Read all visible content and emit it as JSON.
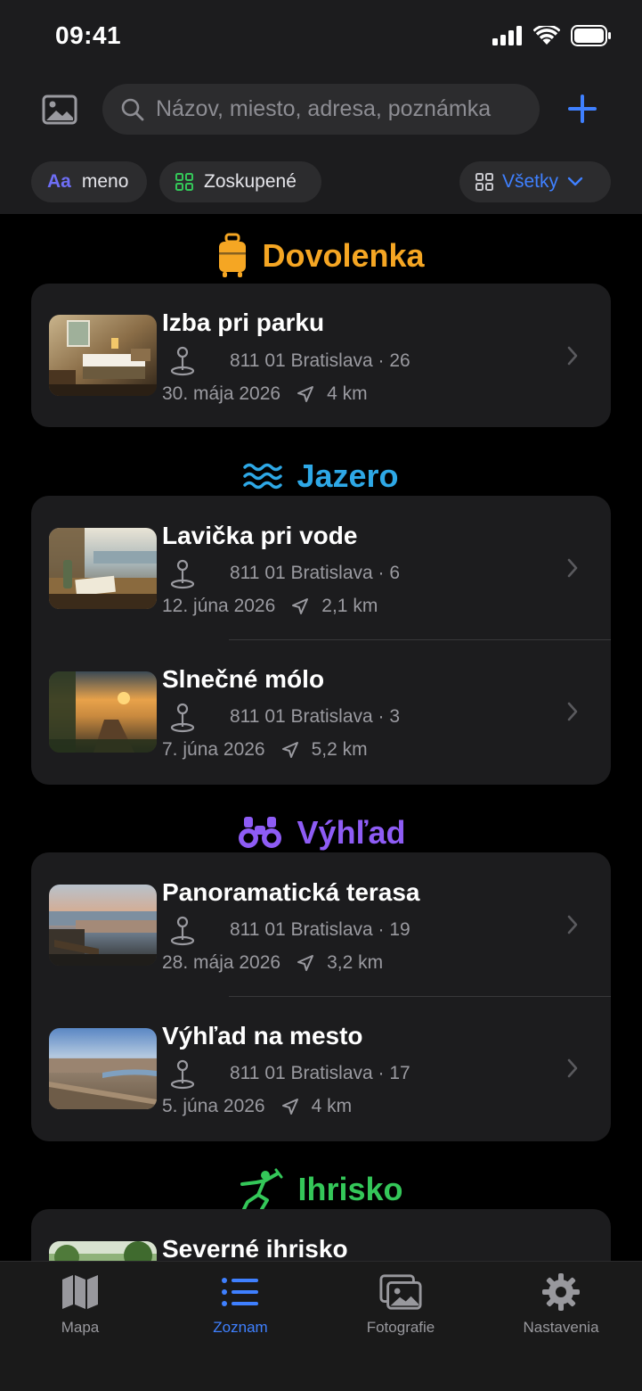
{
  "status_bar": {
    "time": "09:41"
  },
  "search": {
    "placeholder": "Názov, miesto, adresa, poznámka"
  },
  "chips": {
    "sort_prefix": "Aa",
    "sort_label": "meno",
    "group_label": "Zoskupené",
    "filter_label": "Všetky"
  },
  "colors": {
    "accent": "#3f80ff",
    "dovolenka": "#f5a623",
    "jazero": "#2ea8e6",
    "vyhlad": "#8e5cf5",
    "ihrisko": "#34c759"
  },
  "sections": [
    {
      "title": "Dovolenka",
      "icon": "suitcase-icon",
      "items": [
        {
          "title": "Izba pri parku",
          "address": "811 01 Bratislava · 26",
          "date": "30. mája 2026",
          "distance": "4 km"
        }
      ]
    },
    {
      "title": "Jazero",
      "icon": "water-waves-icon",
      "items": [
        {
          "title": "Lavička pri vode",
          "address": "811 01 Bratislava · 6",
          "date": "12. júna 2026",
          "distance": "2,1 km"
        },
        {
          "title": "Slnečné mólo",
          "address": "811 01 Bratislava · 3",
          "date": "7. júna 2026",
          "distance": "5,2 km"
        }
      ]
    },
    {
      "title": "Výhľad",
      "icon": "binoculars-icon",
      "items": [
        {
          "title": "Panoramatická terasa",
          "address": "811 01 Bratislava · 19",
          "date": "28. mája 2026",
          "distance": "3,2 km"
        },
        {
          "title": "Výhľad na mesto",
          "address": "811 01 Bratislava · 17",
          "date": "5. júna 2026",
          "distance": "4 km"
        }
      ]
    },
    {
      "title": "Ihrisko",
      "icon": "playground-icon",
      "items": [
        {
          "title": "Severné ihrisko"
        }
      ]
    }
  ],
  "tabbar": {
    "map": "Mapa",
    "list": "Zoznam",
    "photos": "Fotografie",
    "settings": "Nastavenia"
  }
}
